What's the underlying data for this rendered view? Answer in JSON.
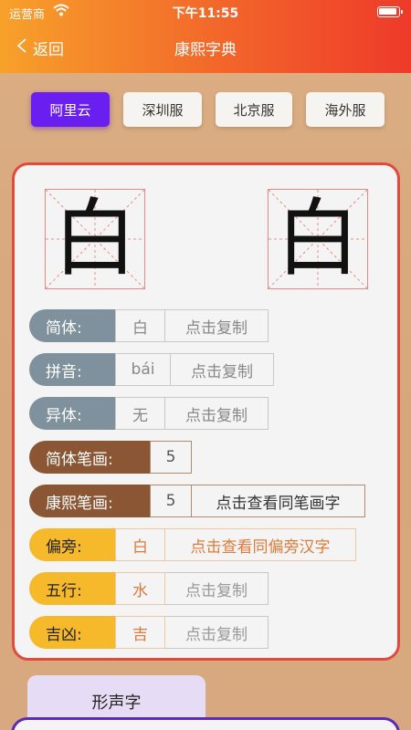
{
  "status_bar": {
    "carrier": "运营商",
    "time": "下午11:55"
  },
  "nav": {
    "back_label": "返回",
    "title": "康熙字典"
  },
  "tabs": [
    {
      "label": "阿里云",
      "active": true
    },
    {
      "label": "深圳服",
      "active": false
    },
    {
      "label": "北京服",
      "active": false
    },
    {
      "label": "海外服",
      "active": false
    }
  ],
  "character": {
    "simplified_glyph": "白",
    "traditional_glyph": "白"
  },
  "rows": {
    "simplified": {
      "label": "简体:",
      "value": "白",
      "action": "点击复制"
    },
    "pinyin": {
      "label": "拼音:",
      "value": "bái",
      "action": "点击复制"
    },
    "variant": {
      "label": "异体:",
      "value": "无",
      "action": "点击复制"
    },
    "simplified_strokes": {
      "label": "简体笔画:",
      "value": "5"
    },
    "kangxi_strokes": {
      "label": "康熙笔画:",
      "value": "5",
      "action": "点击查看同笔画字"
    },
    "radical": {
      "label": "偏旁:",
      "value": "白",
      "action": "点击查看同偏旁汉字"
    },
    "wuxing": {
      "label": "五行:",
      "value": "水",
      "action": "点击复制"
    },
    "jixiong": {
      "label": "吉凶:",
      "value": "吉",
      "action": "点击复制"
    }
  },
  "bottom_tab": {
    "label": "形声字"
  },
  "colors": {
    "header_start": "#f7a12a",
    "header_end": "#ee3a2a",
    "active_tab": "#6a1ff0",
    "card_border": "#e44a3c",
    "gray_label": "#7f919c",
    "brown_label": "#8a5634",
    "yellow_label": "#f6b92c"
  }
}
